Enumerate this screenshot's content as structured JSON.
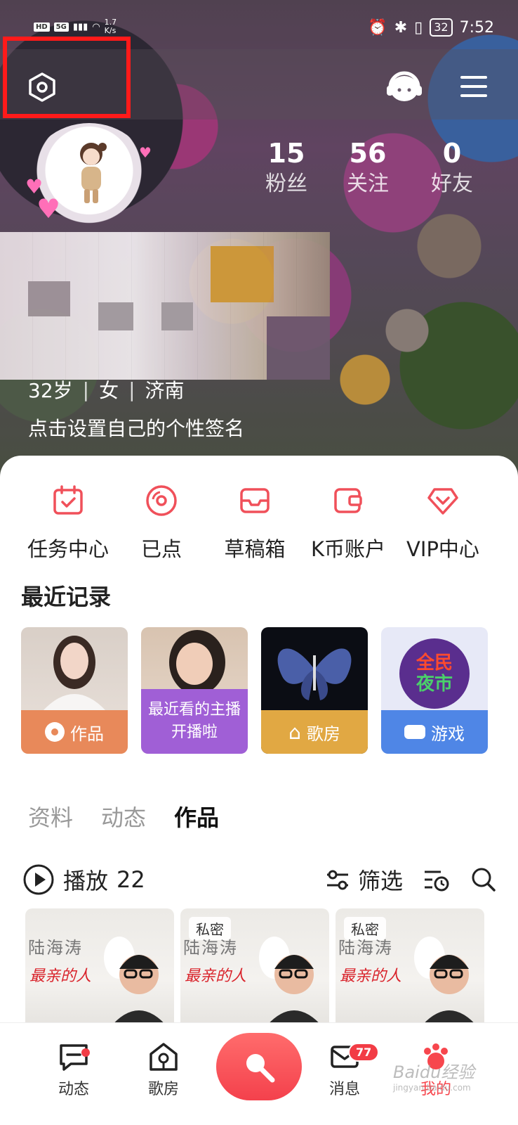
{
  "status_bar": {
    "left_badges": [
      "HD",
      "5G"
    ],
    "speed": "1.7",
    "speed_unit": "K/s",
    "battery": "32",
    "time": "7:52"
  },
  "profile": {
    "stats": [
      {
        "value": "15",
        "label": "粉丝"
      },
      {
        "value": "56",
        "label": "关注"
      },
      {
        "value": "0",
        "label": "好友"
      }
    ],
    "age": "32岁",
    "gender": "女",
    "city": "济南",
    "bio_placeholder": "点击设置自己的个性签名"
  },
  "quick_actions": [
    {
      "label": "任务中心",
      "icon": "calendar-check-icon"
    },
    {
      "label": "已点",
      "icon": "disc-icon"
    },
    {
      "label": "草稿箱",
      "icon": "inbox-icon"
    },
    {
      "label": "K币账户",
      "icon": "wallet-icon"
    },
    {
      "label": "VIP中心",
      "icon": "diamond-icon"
    }
  ],
  "recent": {
    "title": "最近记录",
    "cards": [
      {
        "label": "作品",
        "color": "#e8895a"
      },
      {
        "label": "最近看的主播开播啦",
        "color": "#a05fd6"
      },
      {
        "label": "歌房",
        "color": "#e1a843"
      },
      {
        "label": "游戏",
        "color": "#4f86e6"
      }
    ],
    "game_banner": [
      "全民",
      "夜市"
    ]
  },
  "tabs": [
    "资料",
    "动态",
    "作品"
  ],
  "active_tab": "作品",
  "works_bar": {
    "play_label": "播放",
    "play_count": "22",
    "filter_label": "筛选"
  },
  "works": [
    {
      "tag": "",
      "title": "陆海涛",
      "subtitle": "最亲的人"
    },
    {
      "tag": "私密",
      "title": "陆海涛",
      "subtitle": "最亲的人"
    },
    {
      "tag": "私密",
      "title": "陆海涛",
      "subtitle": "最亲的人"
    }
  ],
  "bottom_nav": {
    "items": [
      "动态",
      "歌房",
      "消息",
      "我的"
    ],
    "messages_badge": "77",
    "active": "我的"
  },
  "watermark": {
    "text": "Baidu经验",
    "sub": "jingyan.baidu.com"
  },
  "colors": {
    "accent": "#f4414c",
    "highlight_box": "#ff1a1a"
  }
}
